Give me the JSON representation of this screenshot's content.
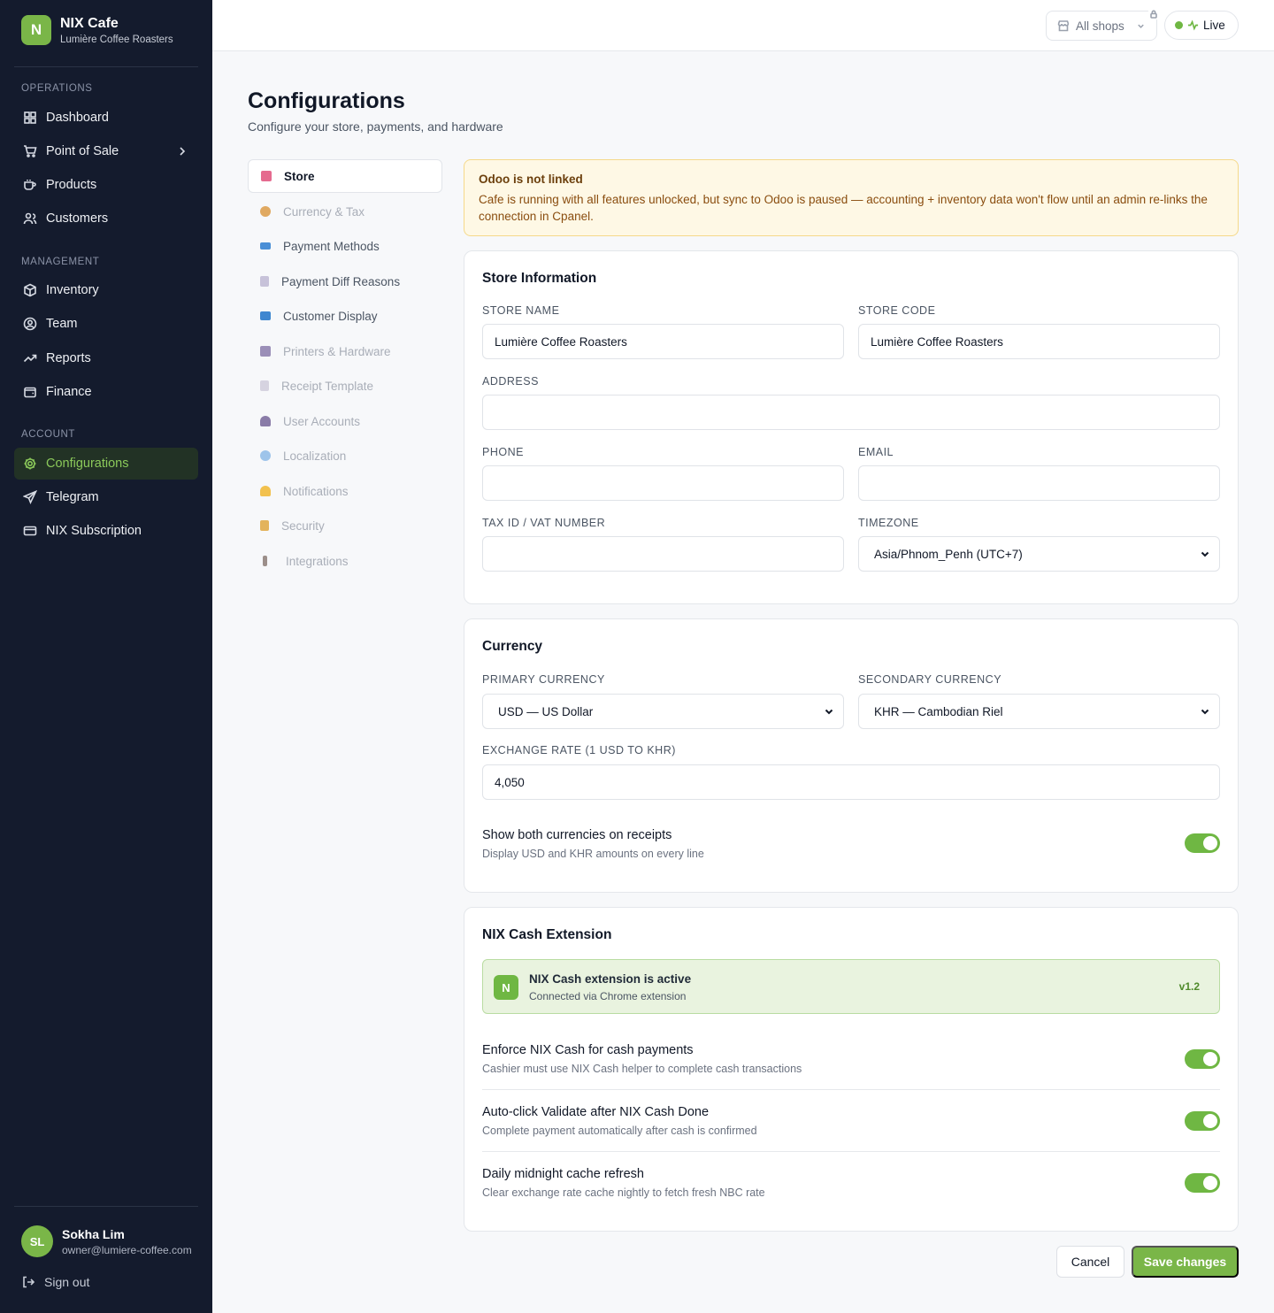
{
  "brand": {
    "name": "NIX Cafe",
    "subtitle": "Lumière Coffee Roasters",
    "logo_letter": "N",
    "accent": "#7ab648"
  },
  "sidebar": {
    "sections": [
      {
        "label": "OPERATIONS"
      },
      {
        "label": "MANAGEMENT"
      },
      {
        "label": "ACCOUNT"
      }
    ],
    "items": [
      {
        "label": "Dashboard",
        "icon": "grid-icon"
      },
      {
        "label": "Point of Sale",
        "icon": "cart-icon",
        "has_submenu": true
      },
      {
        "label": "Products",
        "icon": "cup-icon"
      },
      {
        "label": "Customers",
        "icon": "users-icon"
      },
      {
        "label": "Inventory",
        "icon": "box-icon"
      },
      {
        "label": "Team",
        "icon": "user-circle-icon"
      },
      {
        "label": "Reports",
        "icon": "trend-icon"
      },
      {
        "label": "Finance",
        "icon": "wallet-icon"
      },
      {
        "label": "Configurations",
        "icon": "gear-icon",
        "active": true
      },
      {
        "label": "Telegram",
        "icon": "send-icon"
      },
      {
        "label": "NIX Subscription",
        "icon": "card-icon"
      }
    ],
    "user": {
      "initials": "SL",
      "name": "Sokha Lim",
      "email": "owner@lumiere-coffee.com"
    },
    "signout_label": "Sign out"
  },
  "topbar": {
    "shop_select": "All shops",
    "status": "Live",
    "status_color": "#6fb743"
  },
  "page": {
    "title": "Configurations",
    "subtitle": "Configure your store, payments, and hardware"
  },
  "settings_nav": [
    {
      "label": "Store",
      "icon_color": "#e56b8f",
      "active": true
    },
    {
      "label": "Currency & Tax",
      "icon_color": "#e0a961"
    },
    {
      "label": "Payment Methods",
      "icon_color": "#4a8fd6"
    },
    {
      "label": "Payment Diff Reasons",
      "icon_color": "#c7c2d9"
    },
    {
      "label": "Customer Display",
      "icon_color": "#3f87d0"
    },
    {
      "label": "Printers & Hardware",
      "icon_color": "#9b8fb8"
    },
    {
      "label": "Receipt Template",
      "icon_color": "#d6d3e0"
    },
    {
      "label": "User Accounts",
      "icon_color": "#8a7ca8"
    },
    {
      "label": "Localization",
      "icon_color": "#9ec4ea"
    },
    {
      "label": "Notifications",
      "icon_color": "#f2c14e"
    },
    {
      "label": "Security",
      "icon_color": "#e3b35c"
    },
    {
      "label": "Integrations",
      "icon_color": "#9c8f8a"
    }
  ],
  "alert": {
    "title": "Odoo is not linked",
    "body": "Cafe is running with all features unlocked, but sync to Odoo is paused — accounting + inventory data won't flow until an admin re-links the connection in Cpanel."
  },
  "store_info": {
    "title": "Store Information",
    "store_name": {
      "label": "STORE NAME",
      "value": "Lumière Coffee Roasters"
    },
    "store_code": {
      "label": "STORE CODE",
      "value": "Lumière Coffee Roasters"
    },
    "address": {
      "label": "ADDRESS",
      "value": ""
    },
    "phone": {
      "label": "PHONE",
      "value": ""
    },
    "email": {
      "label": "EMAIL",
      "value": ""
    },
    "tax_id": {
      "label": "TAX ID / VAT NUMBER",
      "value": ""
    },
    "timezone": {
      "label": "TIMEZONE",
      "value": "Asia/Phnom_Penh (UTC+7)"
    }
  },
  "currency": {
    "title": "Currency",
    "primary": {
      "label": "PRIMARY CURRENCY",
      "value": "USD — US Dollar"
    },
    "secondary": {
      "label": "SECONDARY CURRENCY",
      "value": "KHR — Cambodian Riel"
    },
    "rate": {
      "label": "EXCHANGE RATE (1 USD TO KHR)",
      "value": "4,050"
    },
    "show_both": {
      "title": "Show both currencies on receipts",
      "desc": "Display USD and KHR amounts on every line",
      "enabled": true
    }
  },
  "nix_cash": {
    "title": "NIX Cash Extension",
    "status": {
      "logo_letter": "N",
      "title": "NIX Cash extension is active",
      "subtitle": "Connected via Chrome extension",
      "version": "v1.2"
    },
    "toggles": [
      {
        "title": "Enforce NIX Cash for cash payments",
        "desc": "Cashier must use NIX Cash helper to complete cash transactions",
        "enabled": true
      },
      {
        "title": "Auto-click Validate after NIX Cash Done",
        "desc": "Complete payment automatically after cash is confirmed",
        "enabled": true
      },
      {
        "title": "Daily midnight cache refresh",
        "desc": "Clear exchange rate cache nightly to fetch fresh NBC rate",
        "enabled": true
      }
    ]
  },
  "actions": {
    "cancel": "Cancel",
    "save": "Save changes"
  }
}
